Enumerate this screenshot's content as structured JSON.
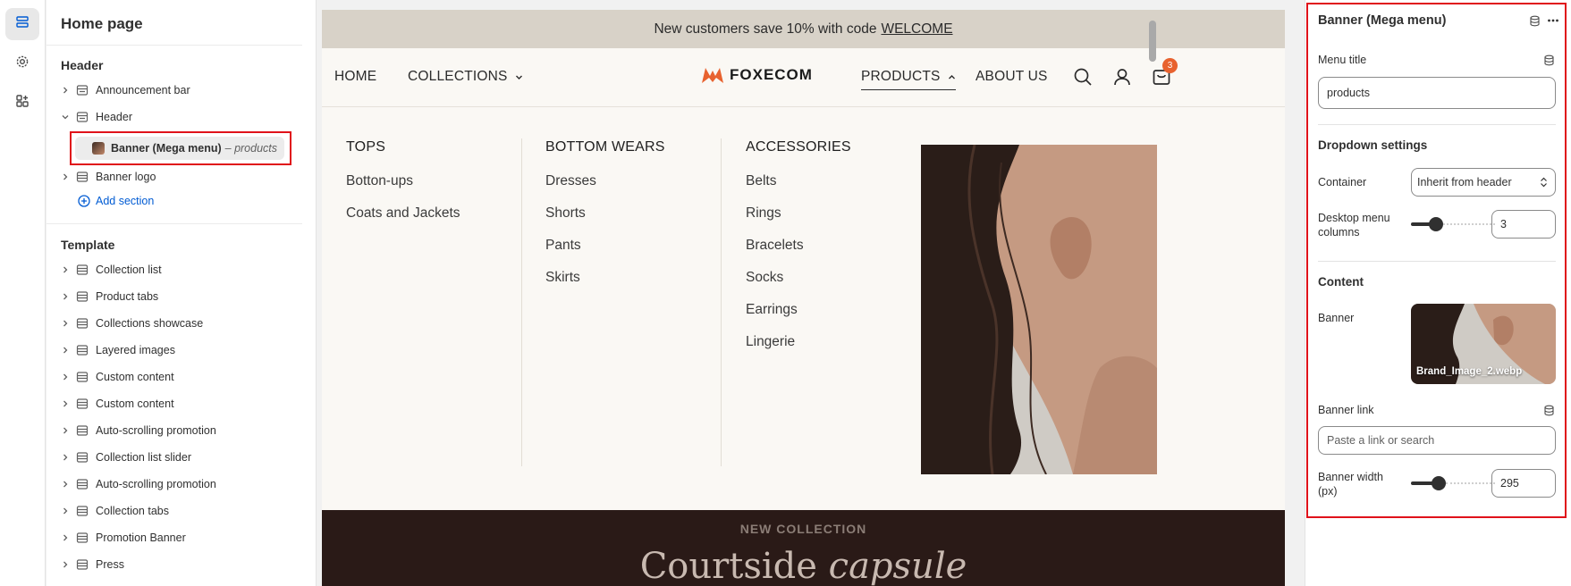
{
  "sections_panel": {
    "title": "Home page",
    "header_group": "Header",
    "header_items": [
      {
        "label": "Announcement bar"
      },
      {
        "label": "Header"
      }
    ],
    "selected_block": {
      "label": "Banner (Mega menu)",
      "suffix": "– products"
    },
    "banner_logo": "Banner logo",
    "add_section": "Add section",
    "template_group": "Template",
    "template_items": [
      "Collection list",
      "Product tabs",
      "Collections showcase",
      "Layered images",
      "Custom content",
      "Custom content",
      "Auto-scrolling promotion",
      "Collection list slider",
      "Auto-scrolling promotion",
      "Collection tabs",
      "Promotion Banner",
      "Press"
    ]
  },
  "store": {
    "announcement": {
      "text": "New customers save 10% with code",
      "code": "WELCOME"
    },
    "nav": {
      "home": "HOME",
      "collections": "COLLECTIONS",
      "logo": "FOXECOM",
      "products": "PRODUCTS",
      "about": "ABOUT US",
      "cart_count": "3"
    },
    "mega_menu": {
      "columns": [
        {
          "heading": "TOPS",
          "links": [
            "Botton-ups",
            "Coats and Jackets"
          ]
        },
        {
          "heading": "BOTTOM WEARS",
          "links": [
            "Dresses",
            "Shorts",
            "Pants",
            "Skirts"
          ]
        },
        {
          "heading": "ACCESSORIES",
          "links": [
            "Belts",
            "Rings",
            "Bracelets",
            "Socks",
            "Earrings",
            "Lingerie"
          ]
        }
      ]
    },
    "hero": {
      "kicker": "NEW COLLECTION",
      "title_plain": "Courtside",
      "title_italic": "capsule"
    }
  },
  "settings": {
    "title": "Banner (Mega menu)",
    "menu_title_label": "Menu title",
    "menu_title_value": "products",
    "dropdown_heading": "Dropdown settings",
    "container_label": "Container",
    "container_value": "Inherit from header",
    "columns_label": "Desktop menu columns",
    "columns_value": "3",
    "content_heading": "Content",
    "banner_label": "Banner",
    "banner_file": "Brand_Image_2.webp",
    "banner_link_label": "Banner link",
    "banner_link_placeholder": "Paste a link or search",
    "banner_width_label": "Banner width (px)",
    "banner_width_value": "295",
    "columns_slider_level": 0.25,
    "width_slider_level": 0.3
  },
  "colors": {
    "highlight": "#e0121a",
    "link_blue": "#005bd3",
    "announcement_bg": "#d8d2c8",
    "cart_badge": "#e8622f",
    "hero_bg": "#2a1a17"
  }
}
